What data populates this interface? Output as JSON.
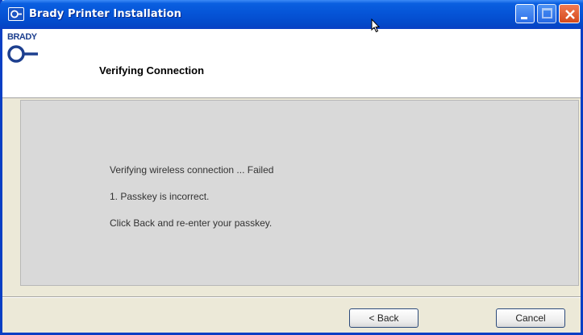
{
  "window": {
    "title": "Brady Printer Installation",
    "icon": "brady-app-icon",
    "controls": {
      "minimize": "minimize-icon",
      "maximize": "maximize-icon",
      "close": "close-icon"
    },
    "accent_color": "#0553d6",
    "close_color": "#d44a1c"
  },
  "header": {
    "logo_text": "BRADY",
    "logo_icon": "brady-logo-icon",
    "logo_color": "#1d3f8f",
    "title": "Verifying Connection"
  },
  "content": {
    "messages": [
      "Verifying wireless connection ... Failed",
      "1. Passkey is incorrect.",
      "Click Back and re-enter your passkey."
    ]
  },
  "buttons": {
    "back_label": "< Back",
    "cancel_label": "Cancel"
  }
}
